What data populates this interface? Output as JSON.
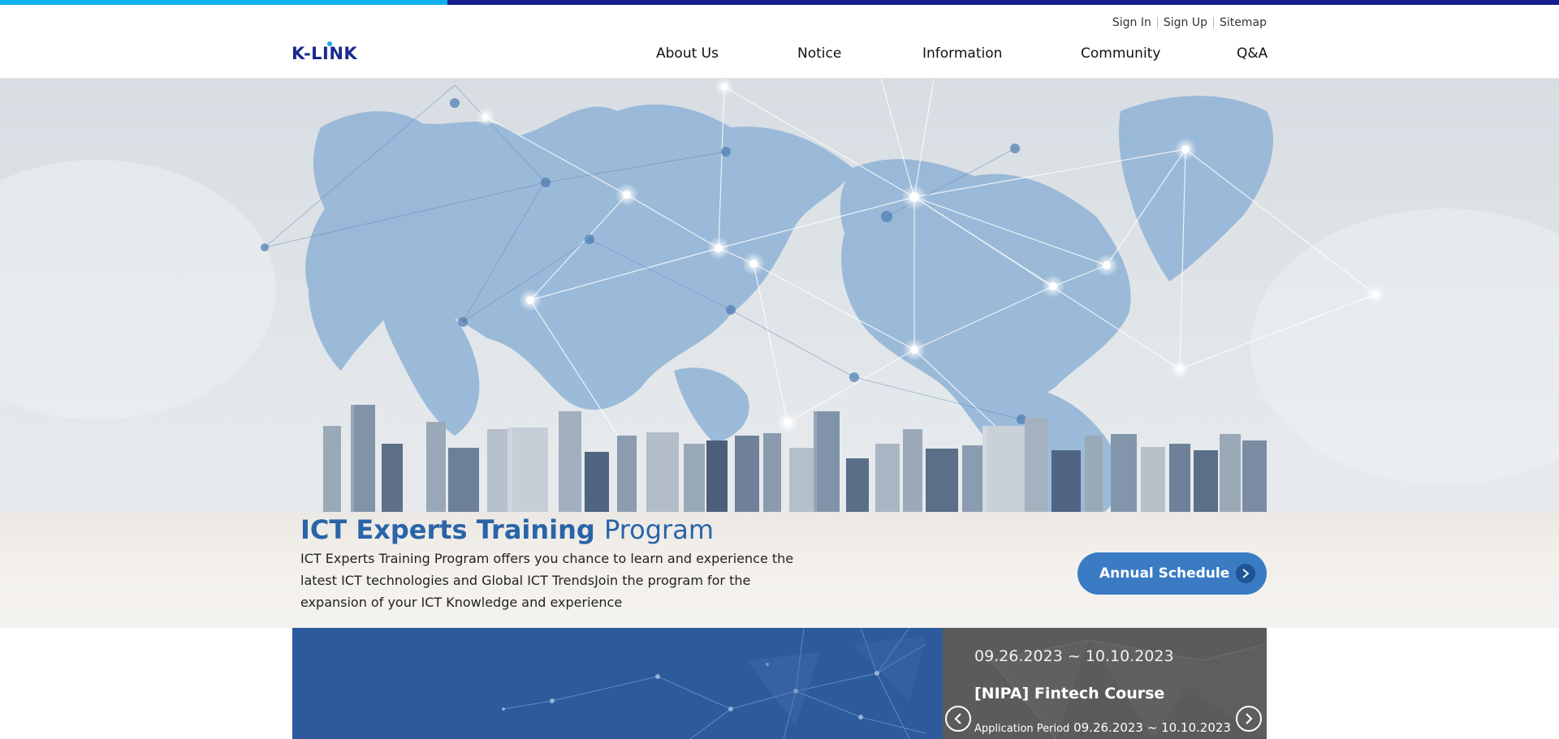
{
  "util_nav": {
    "sign_in": "Sign In",
    "sign_up": "Sign Up",
    "sitemap": "Sitemap"
  },
  "logo": {
    "text": "K-LINK"
  },
  "gnb": [
    {
      "label": "About Us"
    },
    {
      "label": "Notice"
    },
    {
      "label": "Information"
    },
    {
      "label": "Community"
    },
    {
      "label": "Q&A"
    }
  ],
  "hero": {
    "title_bold": "ICT Experts Training",
    "title_light": "Program",
    "description": "ICT Experts Training Program offers you chance to learn and experience the latest ICT technologies and Global ICT TrendsJoin the program for the expansion of your ICT Knowledge and experience",
    "button_label": "Annual Schedule"
  },
  "course_slider": {
    "date_range": "09.26.2023 ~ 10.10.2023",
    "title": "[NIPA] Fintech Course",
    "period_label": "Application Period",
    "period_value": "09.26.2023 ~ 10.10.2023"
  },
  "colors": {
    "accent_cyan": "#12b0ea",
    "accent_navy": "#141e8c",
    "hero_title": "#2a64a8",
    "button_blue": "#3a7bc3",
    "panel_blue": "#2c5a9d",
    "panel_gray": "#5b5b5b"
  }
}
